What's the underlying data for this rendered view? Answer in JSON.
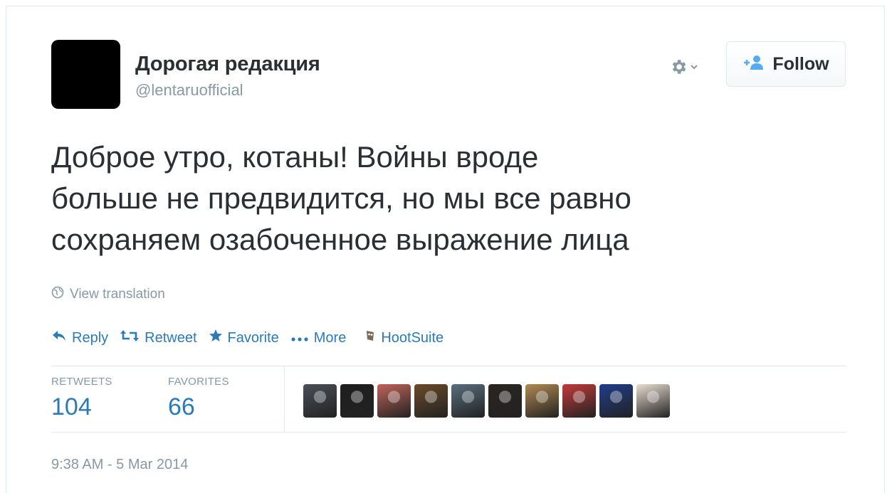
{
  "author": {
    "display_name": "Дорогая редакция",
    "handle": "@lentaruofficial"
  },
  "header_controls": {
    "gear_icon": "gear-icon",
    "follow_label": "Follow"
  },
  "tweet": {
    "text": "Доброе утро, котаны! Войны вроде\nбольше не предвидится, но мы все равно\nсохраняем озабоченное выражение лица",
    "view_translation": "View translation"
  },
  "actions": [
    {
      "icon": "reply-icon",
      "label": "Reply"
    },
    {
      "icon": "retweet-icon",
      "label": "Retweet"
    },
    {
      "icon": "star-icon",
      "label": "Favorite"
    },
    {
      "icon": "more-dots-icon",
      "label": "More"
    },
    {
      "icon": "hootsuite-icon",
      "label": "HootSuite"
    }
  ],
  "stats": {
    "retweets_label": "RETWEETS",
    "retweets_value": "104",
    "favorites_label": "FAVORITES",
    "favorites_value": "66"
  },
  "favoriters": [
    {
      "color": "#4a5058"
    },
    {
      "color": "#1e1e1e"
    },
    {
      "color": "#c0645a"
    },
    {
      "color": "#6b4a2a"
    },
    {
      "color": "#5a6e7e"
    },
    {
      "color": "#2a2520"
    },
    {
      "color": "#b08a52"
    },
    {
      "color": "#c23a3a"
    },
    {
      "color": "#1f3d8a"
    },
    {
      "color": "#e8ddd0"
    }
  ],
  "timestamp": "9:38 AM - 5 Mar 2014",
  "colors": {
    "link_blue": "#2b7bb9",
    "muted_gray": "#8899a6",
    "text_dark": "#292f33"
  }
}
